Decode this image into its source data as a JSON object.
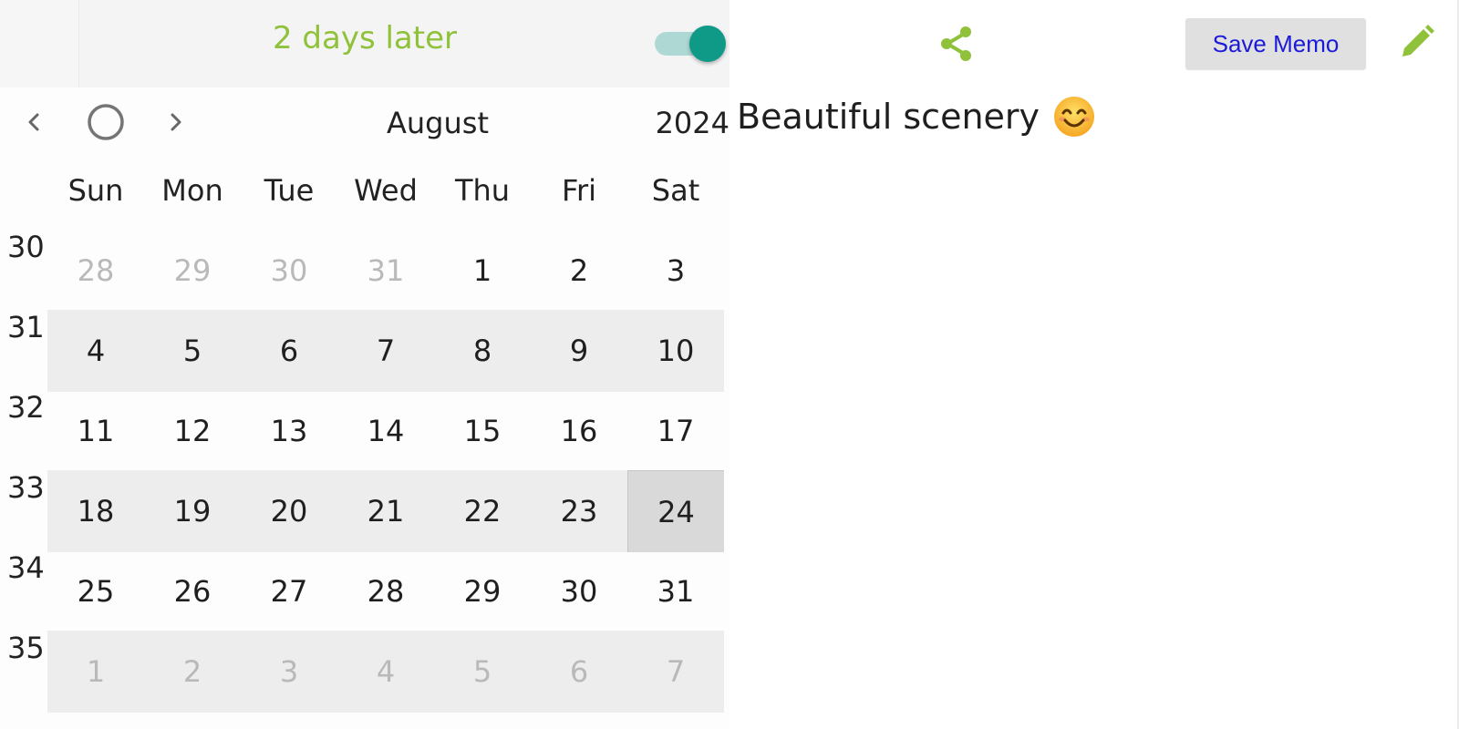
{
  "header": {
    "days_later": "2 days later",
    "toggle_on": true
  },
  "calendar": {
    "month": "August",
    "year": "2024",
    "weekdays": [
      "Sun",
      "Mon",
      "Tue",
      "Wed",
      "Thu",
      "Fri",
      "Sat"
    ],
    "weeks": [
      {
        "num": "30",
        "days": [
          "28",
          "29",
          "30",
          "31",
          "1",
          "2",
          "3"
        ]
      },
      {
        "num": "31",
        "days": [
          "4",
          "5",
          "6",
          "7",
          "8",
          "9",
          "10"
        ]
      },
      {
        "num": "32",
        "days": [
          "11",
          "12",
          "13",
          "14",
          "15",
          "16",
          "17"
        ]
      },
      {
        "num": "33",
        "days": [
          "18",
          "19",
          "20",
          "21",
          "22",
          "23",
          "24"
        ]
      },
      {
        "num": "34",
        "days": [
          "25",
          "26",
          "27",
          "28",
          "29",
          "30",
          "31"
        ]
      },
      {
        "num": "35",
        "days": [
          "1",
          "2",
          "3",
          "4",
          "5",
          "6",
          "7"
        ]
      }
    ],
    "selected_day": "24"
  },
  "toolbar": {
    "save_label": "Save Memo"
  },
  "memo": {
    "text": "Beautiful scenery",
    "emoji": "smiling-face-icon"
  },
  "colors": {
    "accent_green": "#8fc23a",
    "toggle_teal": "#0e9a86",
    "save_text_blue": "#1a1ad8",
    "shaded_row": "#ededed",
    "selected_cell": "#d9d9d9"
  }
}
